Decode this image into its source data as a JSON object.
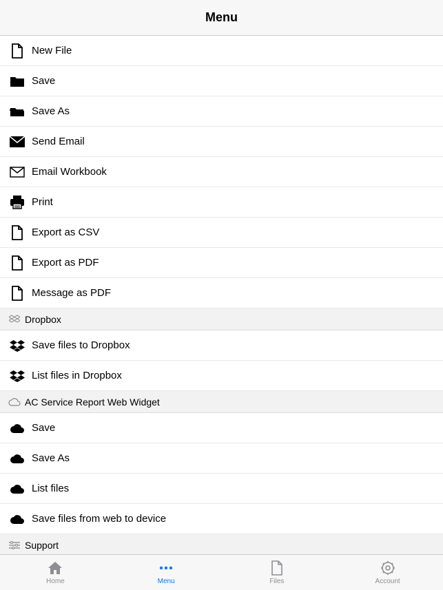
{
  "header": {
    "title": "Menu"
  },
  "rows": [
    {
      "label": "New File"
    },
    {
      "label": "Save"
    },
    {
      "label": "Save As"
    },
    {
      "label": "Send Email"
    },
    {
      "label": "Email Workbook"
    },
    {
      "label": "Print"
    },
    {
      "label": "Export as CSV"
    },
    {
      "label": "Export as PDF"
    },
    {
      "label": "Message as PDF"
    }
  ],
  "section_dropbox": {
    "label": "Dropbox"
  },
  "dropbox_rows": [
    {
      "label": "Save files to Dropbox"
    },
    {
      "label": "List files in Dropbox"
    }
  ],
  "section_ac": {
    "label": "AC Service Report Web Widget"
  },
  "ac_rows": [
    {
      "label": "Save"
    },
    {
      "label": "Save As"
    },
    {
      "label": "List files"
    },
    {
      "label": "Save files from web to device"
    }
  ],
  "section_support": {
    "label": "Support"
  },
  "tabs": {
    "home": "Home",
    "menu": "Menu",
    "files": "Files",
    "account": "Account"
  }
}
